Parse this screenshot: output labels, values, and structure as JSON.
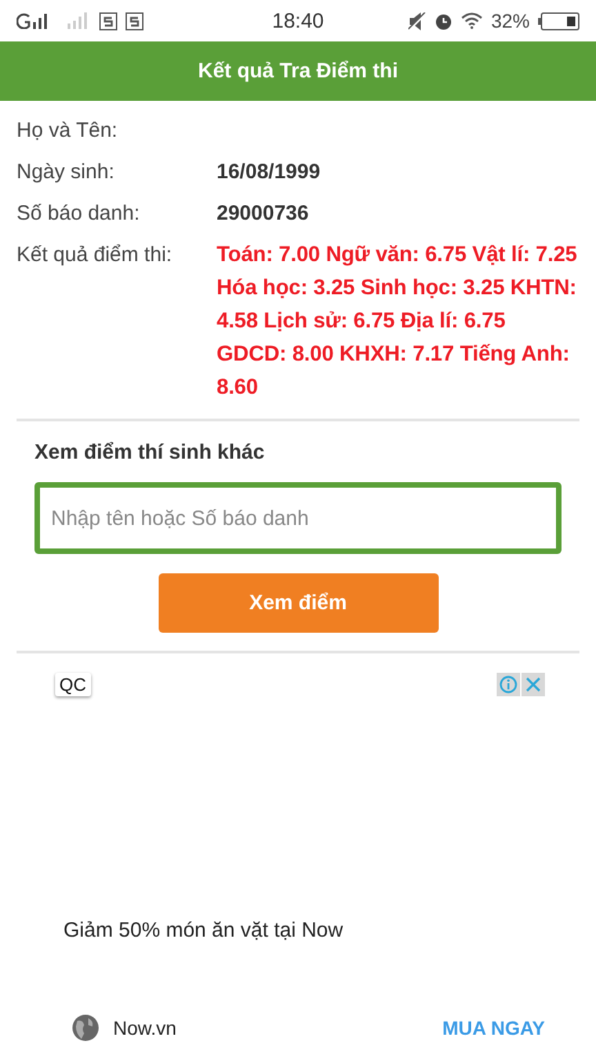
{
  "status_bar": {
    "time": "18:40",
    "battery": "32%"
  },
  "header": {
    "title": "Kết quả Tra Điểm thi"
  },
  "info_rows": [
    {
      "label": "Họ và Tên:",
      "value": ""
    },
    {
      "label": "Ngày sinh:",
      "value": "16/08/1999"
    },
    {
      "label": "Số báo danh:",
      "value": "29000736"
    }
  ],
  "results": {
    "label": "Kết quả điểm thi:",
    "value": "Toán: 7.00 Ngữ văn: 6.75 Vật lí: 7.25 Hóa học: 3.25 Sinh học: 3.25 KHTN: 4.58 Lịch sử: 6.75 Địa lí: 6.75 GDCD: 8.00 KHXH: 7.17 Tiếng Anh: 8.60"
  },
  "search": {
    "title": "Xem điểm thí sinh khác",
    "placeholder": "Nhập tên hoặc Số báo danh",
    "button": "Xem điểm"
  },
  "ad": {
    "badge": "QC",
    "headline": "Giảm 50% món ăn vặt tại Now",
    "site": "Now.vn",
    "cta": "MUA NGAY"
  }
}
